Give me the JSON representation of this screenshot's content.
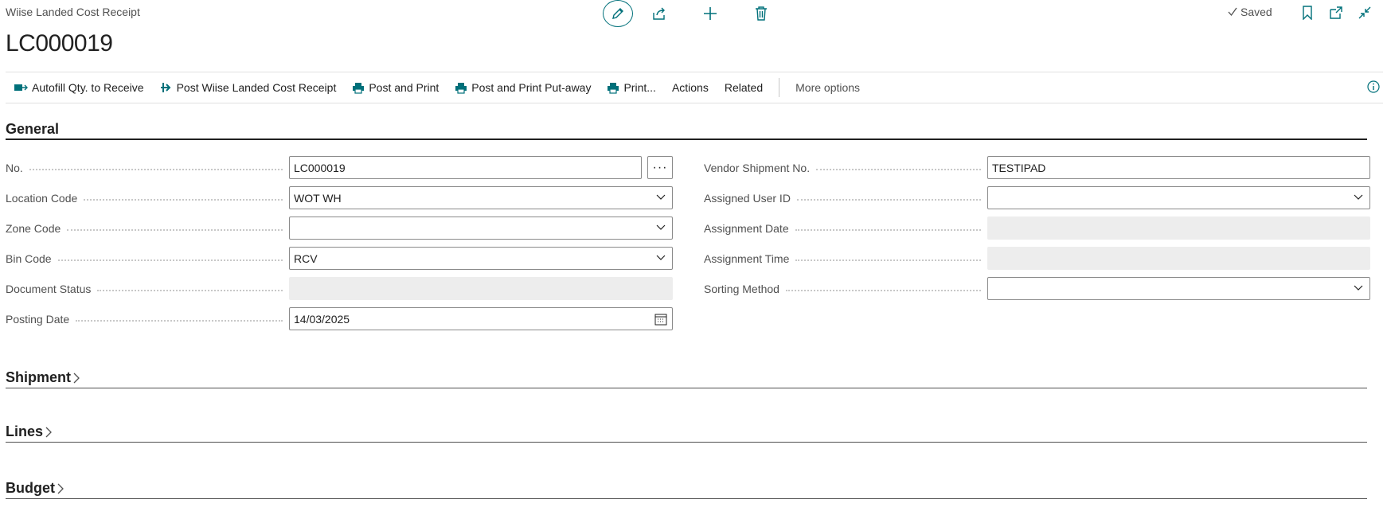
{
  "header": {
    "caption": "Wiise Landed Cost Receipt",
    "record_no": "LC000019",
    "saved_status": "Saved"
  },
  "actions": {
    "autofill": "Autofill Qty. to Receive",
    "post": "Post Wiise Landed Cost Receipt",
    "post_print": "Post and Print",
    "post_print_putaway": "Post and Print Put-away",
    "print": "Print...",
    "actions": "Actions",
    "related": "Related",
    "more_options": "More options"
  },
  "sections": {
    "general": "General",
    "shipment": "Shipment",
    "lines": "Lines",
    "budget": "Budget"
  },
  "general_left": [
    {
      "label": "No.",
      "value": "LC000019"
    },
    {
      "label": "Location Code",
      "value": "WOT WH"
    },
    {
      "label": "Zone Code",
      "value": ""
    },
    {
      "label": "Bin Code",
      "value": "RCV"
    },
    {
      "label": "Document Status",
      "value": ""
    },
    {
      "label": "Posting Date",
      "value": "14/03/2025"
    }
  ],
  "general_right": [
    {
      "label": "Vendor Shipment No.",
      "value": "TESTIPAD"
    },
    {
      "label": "Assigned User ID",
      "value": ""
    },
    {
      "label": "Assignment Date",
      "value": ""
    },
    {
      "label": "Assignment Time",
      "value": ""
    },
    {
      "label": "Sorting Method",
      "value": ""
    }
  ],
  "colors": {
    "accent": "#00707a",
    "text": "#212121",
    "muted": "#505050",
    "readonly_bg": "#ededed"
  }
}
